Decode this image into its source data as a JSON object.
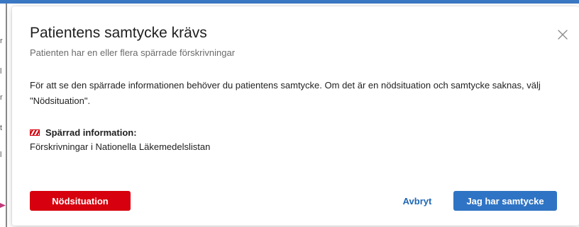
{
  "dialog": {
    "title": "Patientens samtycke krävs",
    "subtitle": "Patienten har en eller flera spärrade förskrivningar",
    "body_text": "För att se den spärrade informationen behöver du patientens samtycke. Om det är en nödsituation och samtycke saknas, välj \"Nödsituation\".",
    "restricted_label": "Spärrad information:",
    "restricted_value": "Förskrivningar i Nationella Läkemedelslistan",
    "restricted_icon": "restricted-stripes-icon",
    "close_icon": "close-icon",
    "buttons": {
      "emergency": "Nödsituation",
      "cancel": "Avbryt",
      "consent": "Jag har samtycke"
    }
  },
  "colors": {
    "emergency": "#d6000e",
    "primary": "#2f74c4",
    "link": "#1f67b5",
    "top_bar": "#3b78c4"
  }
}
